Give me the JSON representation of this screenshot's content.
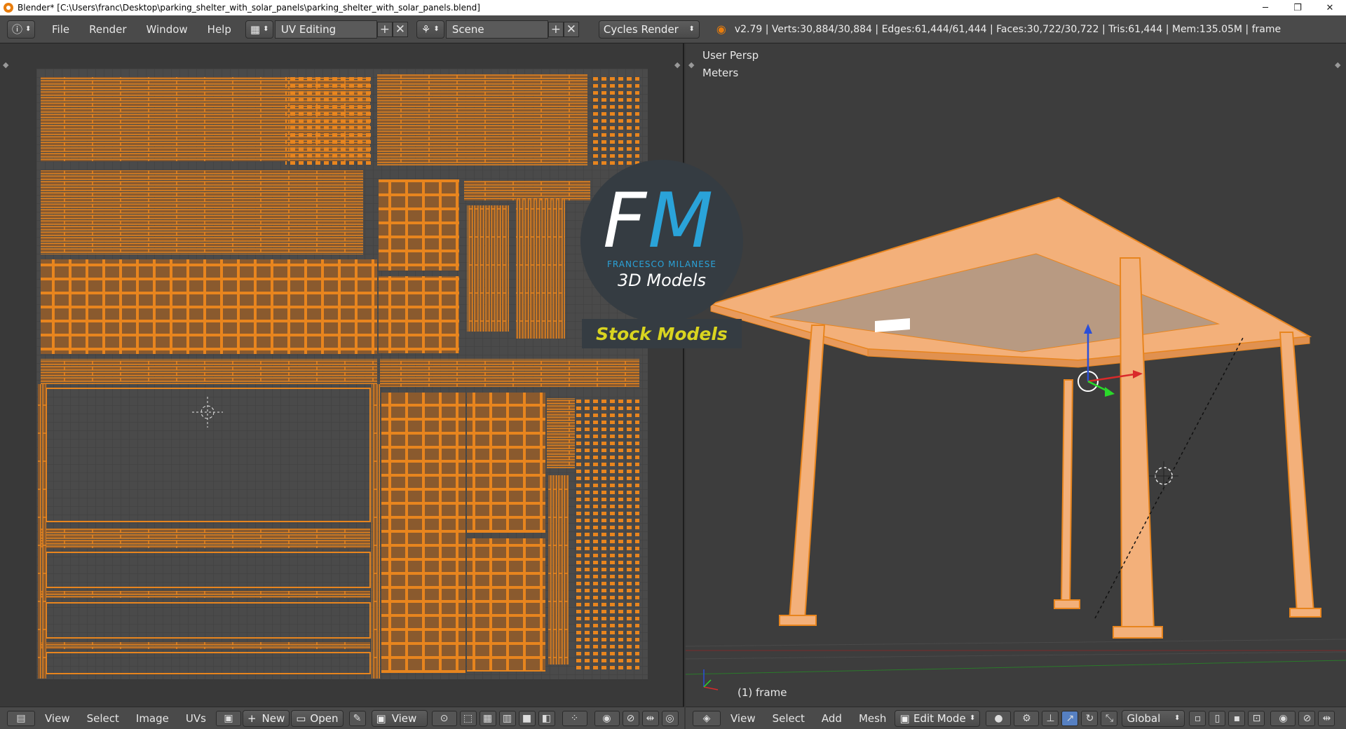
{
  "window": {
    "title": "Blender* [C:\\Users\\franc\\Desktop\\parking_shelter_with_solar_panels\\parking_shelter_with_solar_panels.blend]",
    "minimize": "─",
    "restore": "❐",
    "close": "✕"
  },
  "topbar": {
    "menus": [
      "File",
      "Render",
      "Window",
      "Help"
    ],
    "layout": "UV Editing",
    "scene": "Scene",
    "engine": "Cycles Render",
    "stats": "v2.79 | Verts:30,884/30,884 | Edges:61,444/61,444 | Faces:30,722/30,722 | Tris:61,444 | Mem:135.05M | frame"
  },
  "viewport": {
    "view_name": "User Persp",
    "units": "Meters",
    "object_label": "(1) frame"
  },
  "uv_bottom": {
    "view": "View",
    "select": "Select",
    "image": "Image",
    "uvs": "UVs",
    "new": "New",
    "open": "Open",
    "view2": "View"
  },
  "vp_bottom": {
    "view": "View",
    "select": "Select",
    "add": "Add",
    "mesh": "Mesh",
    "mode": "Edit Mode",
    "orientation": "Global"
  },
  "logo": {
    "f": "F",
    "m": "M",
    "subtitle": "FRANCESCO MILANESE",
    "tagline": "3D Models",
    "banner": "Stock Models"
  },
  "colors": {
    "uv_orange": "#e8851e",
    "uv_fill": "#8a5a2e",
    "frame_peach": "#f3b07a",
    "accent_blue": "#2aa3d9",
    "stock_yellow": "#d9d420"
  }
}
